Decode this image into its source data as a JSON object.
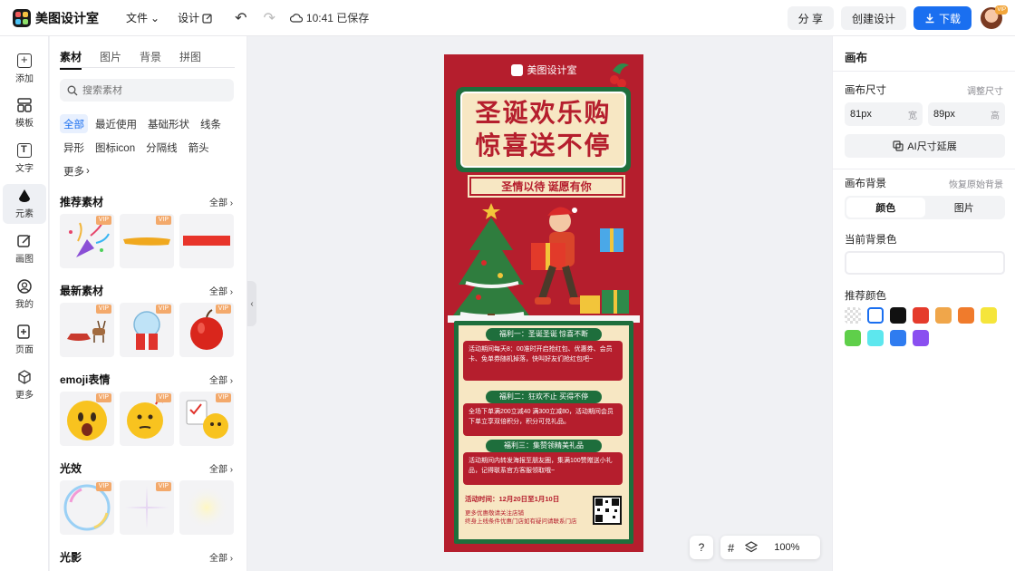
{
  "app": {
    "name": "美图设计室"
  },
  "topbar": {
    "menu": [
      {
        "label": "文件"
      },
      {
        "label": "设计"
      }
    ],
    "save_status": "10:41 已保存",
    "share_label": "分 享",
    "create_label": "创建设计",
    "download_label": "下载",
    "avatar_badge": "VIP"
  },
  "leftnav": {
    "items": [
      {
        "label": "添加"
      },
      {
        "label": "模板"
      },
      {
        "label": "文字"
      },
      {
        "label": "元素"
      },
      {
        "label": "画图"
      },
      {
        "label": "我的"
      },
      {
        "label": "页面"
      },
      {
        "label": "更多"
      }
    ]
  },
  "panel": {
    "tabs": [
      "素材",
      "图片",
      "背景",
      "拼图"
    ],
    "search_placeholder": "搜索素材",
    "chips": [
      "全部",
      "最近使用",
      "基础形状",
      "线条",
      "异形",
      "图标icon",
      "分隔线",
      "箭头",
      "更多"
    ],
    "sections": [
      {
        "title": "推荐素材",
        "all": "全部"
      },
      {
        "title": "最新素材",
        "all": "全部"
      },
      {
        "title": "emoji表情",
        "all": "全部"
      },
      {
        "title": "光效",
        "all": "全部"
      },
      {
        "title": "光影",
        "all": "全部"
      }
    ],
    "vip_label": "VIP"
  },
  "canvas": {
    "brand": "美图设计室",
    "headline_1": "圣诞欢乐购",
    "headline_2": "惊喜送不停",
    "banner": "圣情以待 诞愿有你",
    "perks": [
      {
        "title": "福利一：圣诞圣诞 惊喜不断",
        "body": "活动期间每天8：00准时开启抢红包、优惠券、会员卡、免单券随机掉落，快叫好友们抢红包吧~"
      },
      {
        "title": "福利二：狂欢不止 买得不停",
        "body": "全场下单满200立减40 满300立减80，活动期间会员下单立享双倍积分，积分可兑礼品。"
      },
      {
        "title": "福利三：集赞领精美礼品",
        "body": "活动期间内转发海报至朋友圈，集满100赞赠送小礼品，记得联系官方客服领取哦~"
      }
    ],
    "time": "活动时间：12月20日至1月10日",
    "footnote_1": "更多优惠敬请关注店铺",
    "footnote_2": "终身上线条件优惠门店如有疑问请联系门店"
  },
  "zoom": {
    "help": "?",
    "value": "100%"
  },
  "rightpanel": {
    "title": "画布",
    "size_label": "画布尺寸",
    "size_adjust": "调整尺寸",
    "width_value": "81px",
    "width_unit": "宽",
    "height_value": "89px",
    "height_unit": "高",
    "ai_label": "AI尺寸延展",
    "bg_label": "画布背景",
    "bg_reset": "恢复原始背景",
    "seg": [
      "颜色",
      "图片"
    ],
    "current_bg": "当前背景色",
    "recommend": "推荐颜色",
    "colors": [
      "transparent",
      "#ffffff",
      "#111111",
      "#e53b2c",
      "#f0a64a",
      "#f07b2c",
      "#f5e53b",
      "#5fcf4a",
      "#5de7ee",
      "#2f7cf0",
      "#8a4ff0"
    ]
  },
  "colors": {
    "accent": "#1a6ff0",
    "poster_red": "#b51e2d",
    "poster_green": "#1e6e3c",
    "poster_cream": "#f7e7c3"
  }
}
